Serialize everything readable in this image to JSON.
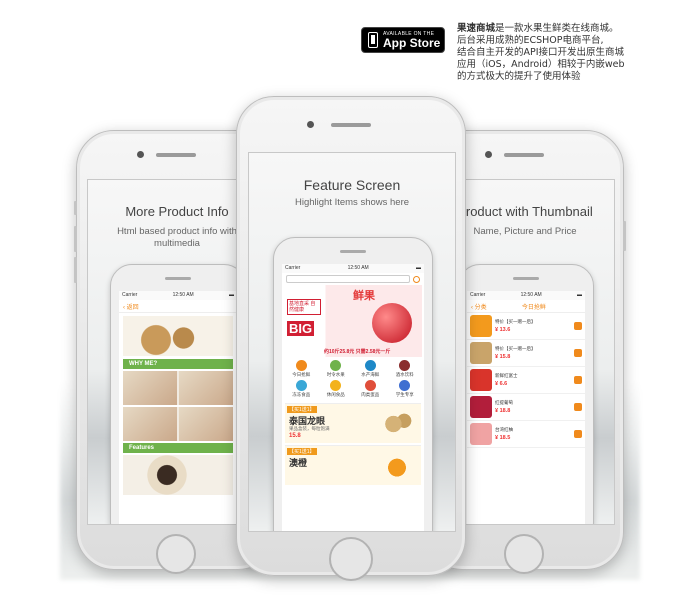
{
  "header": {
    "badge_small": "AVAILABLE ON THE",
    "badge_big": "App Store",
    "desc_brand": "果速商城",
    "desc_line1": "是一款水果生鲜类在线商城。",
    "desc_line2": "后台采用成熟的ECSHOP电商平台,",
    "desc_line3": "结合自主开发的API接口开发出原生商城",
    "desc_line4": "应用（iOS，Android）相较于内嵌web",
    "desc_line5": "的方式极大的提升了使用体验"
  },
  "phones": {
    "left": {
      "title": "More Product Info",
      "subtitle_line1": "Html based product info with",
      "subtitle_line2": "multimedia",
      "status_carrier": "Carrier",
      "status_time": "12:50 AM",
      "back_label": "返回",
      "section1": "WHY ME?",
      "section2": "Features"
    },
    "center": {
      "title": "Feature Screen",
      "subtitle": "Highlight Items shows here",
      "status_carrier": "Carrier",
      "status_time": "12:50 AM",
      "banner_brand": "鲜果",
      "banner_text": "基地直采 自然健康",
      "banner_big": "BIG",
      "banner_price": "约10斤25.8元 只需2.58元一斤",
      "categories": [
        {
          "label": "今日抢鲜",
          "color": "#f08a1c"
        },
        {
          "label": "时令水果",
          "color": "#6fb24b"
        },
        {
          "label": "水产海鲜",
          "color": "#1e88c7"
        },
        {
          "label": "酒水饮料",
          "color": "#8a2d2d"
        },
        {
          "label": "冻冻食品",
          "color": "#3aa7d6"
        },
        {
          "label": "休闲食品",
          "color": "#f3b21c"
        },
        {
          "label": "肉类蛋品",
          "color": "#e04e3a"
        },
        {
          "label": "学生专享",
          "color": "#3f6fd1"
        }
      ],
      "promo1": {
        "tag": "【买1送1】",
        "name": "泰国龙眼",
        "sub": "果品盒装，每粒饱满",
        "price": "15.8"
      },
      "promo2": {
        "tag": "【买1送1】",
        "name": "澳橙"
      }
    },
    "right": {
      "title": "Product with Thumbnail",
      "subtitle": "Name, Picture and Price",
      "status_carrier": "Carrier",
      "status_time": "12:50 AM",
      "back_label": "分类",
      "nav_title": "今日抢鲜",
      "items": [
        {
          "name": "特价【买一赠一后】",
          "price": "¥ 13.6",
          "color": "#f39a1d"
        },
        {
          "name": "特价【买一赠一后】",
          "price": "¥ 15.8",
          "color": "#c9a46a"
        },
        {
          "name": "新鲜红富士",
          "price": "¥ 6.6",
          "color": "#d9342b"
        },
        {
          "name": "红提葡萄",
          "price": "¥ 18.8",
          "color": "#b21e3b"
        },
        {
          "name": "台湾红柚",
          "price": "¥ 18.5",
          "color": "#f0a3a3"
        }
      ]
    }
  }
}
